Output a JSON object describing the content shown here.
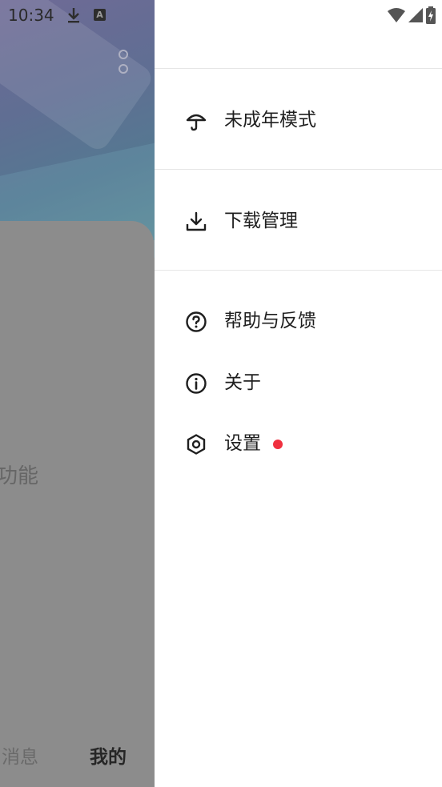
{
  "status_bar": {
    "time": "10:34",
    "keyboard_indicator": "A"
  },
  "background_app": {
    "feature_text": "功能",
    "tabs": {
      "messages": "消息",
      "mine": "我的"
    }
  },
  "drawer": {
    "menu": [
      {
        "label": "未成年模式",
        "icon": "umbrella-icon"
      },
      {
        "label": "下载管理",
        "icon": "download-icon"
      },
      {
        "label": "帮助与反馈",
        "icon": "help-circle-icon"
      },
      {
        "label": "关于",
        "icon": "info-circle-icon"
      },
      {
        "label": "设置",
        "icon": "settings-hexagon-icon",
        "badge": true
      }
    ]
  },
  "colors": {
    "badge": "#f0303f",
    "scrim": "#8f8f8f"
  }
}
